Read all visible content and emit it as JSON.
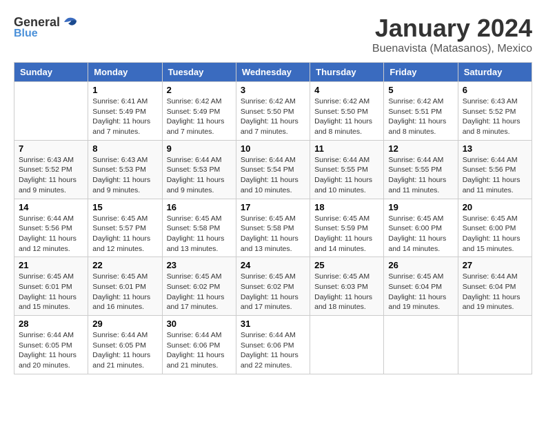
{
  "header": {
    "logo_general": "General",
    "logo_blue": "Blue",
    "month_title": "January 2024",
    "location": "Buenavista (Matasanos), Mexico"
  },
  "weekdays": [
    "Sunday",
    "Monday",
    "Tuesday",
    "Wednesday",
    "Thursday",
    "Friday",
    "Saturday"
  ],
  "weeks": [
    [
      {
        "day": "",
        "sunrise": "",
        "sunset": "",
        "daylight": ""
      },
      {
        "day": "1",
        "sunrise": "Sunrise: 6:41 AM",
        "sunset": "Sunset: 5:49 PM",
        "daylight": "Daylight: 11 hours and 7 minutes."
      },
      {
        "day": "2",
        "sunrise": "Sunrise: 6:42 AM",
        "sunset": "Sunset: 5:49 PM",
        "daylight": "Daylight: 11 hours and 7 minutes."
      },
      {
        "day": "3",
        "sunrise": "Sunrise: 6:42 AM",
        "sunset": "Sunset: 5:50 PM",
        "daylight": "Daylight: 11 hours and 7 minutes."
      },
      {
        "day": "4",
        "sunrise": "Sunrise: 6:42 AM",
        "sunset": "Sunset: 5:50 PM",
        "daylight": "Daylight: 11 hours and 8 minutes."
      },
      {
        "day": "5",
        "sunrise": "Sunrise: 6:42 AM",
        "sunset": "Sunset: 5:51 PM",
        "daylight": "Daylight: 11 hours and 8 minutes."
      },
      {
        "day": "6",
        "sunrise": "Sunrise: 6:43 AM",
        "sunset": "Sunset: 5:52 PM",
        "daylight": "Daylight: 11 hours and 8 minutes."
      }
    ],
    [
      {
        "day": "7",
        "sunrise": "Sunrise: 6:43 AM",
        "sunset": "Sunset: 5:52 PM",
        "daylight": "Daylight: 11 hours and 9 minutes."
      },
      {
        "day": "8",
        "sunrise": "Sunrise: 6:43 AM",
        "sunset": "Sunset: 5:53 PM",
        "daylight": "Daylight: 11 hours and 9 minutes."
      },
      {
        "day": "9",
        "sunrise": "Sunrise: 6:44 AM",
        "sunset": "Sunset: 5:53 PM",
        "daylight": "Daylight: 11 hours and 9 minutes."
      },
      {
        "day": "10",
        "sunrise": "Sunrise: 6:44 AM",
        "sunset": "Sunset: 5:54 PM",
        "daylight": "Daylight: 11 hours and 10 minutes."
      },
      {
        "day": "11",
        "sunrise": "Sunrise: 6:44 AM",
        "sunset": "Sunset: 5:55 PM",
        "daylight": "Daylight: 11 hours and 10 minutes."
      },
      {
        "day": "12",
        "sunrise": "Sunrise: 6:44 AM",
        "sunset": "Sunset: 5:55 PM",
        "daylight": "Daylight: 11 hours and 11 minutes."
      },
      {
        "day": "13",
        "sunrise": "Sunrise: 6:44 AM",
        "sunset": "Sunset: 5:56 PM",
        "daylight": "Daylight: 11 hours and 11 minutes."
      }
    ],
    [
      {
        "day": "14",
        "sunrise": "Sunrise: 6:44 AM",
        "sunset": "Sunset: 5:56 PM",
        "daylight": "Daylight: 11 hours and 12 minutes."
      },
      {
        "day": "15",
        "sunrise": "Sunrise: 6:45 AM",
        "sunset": "Sunset: 5:57 PM",
        "daylight": "Daylight: 11 hours and 12 minutes."
      },
      {
        "day": "16",
        "sunrise": "Sunrise: 6:45 AM",
        "sunset": "Sunset: 5:58 PM",
        "daylight": "Daylight: 11 hours and 13 minutes."
      },
      {
        "day": "17",
        "sunrise": "Sunrise: 6:45 AM",
        "sunset": "Sunset: 5:58 PM",
        "daylight": "Daylight: 11 hours and 13 minutes."
      },
      {
        "day": "18",
        "sunrise": "Sunrise: 6:45 AM",
        "sunset": "Sunset: 5:59 PM",
        "daylight": "Daylight: 11 hours and 14 minutes."
      },
      {
        "day": "19",
        "sunrise": "Sunrise: 6:45 AM",
        "sunset": "Sunset: 6:00 PM",
        "daylight": "Daylight: 11 hours and 14 minutes."
      },
      {
        "day": "20",
        "sunrise": "Sunrise: 6:45 AM",
        "sunset": "Sunset: 6:00 PM",
        "daylight": "Daylight: 11 hours and 15 minutes."
      }
    ],
    [
      {
        "day": "21",
        "sunrise": "Sunrise: 6:45 AM",
        "sunset": "Sunset: 6:01 PM",
        "daylight": "Daylight: 11 hours and 15 minutes."
      },
      {
        "day": "22",
        "sunrise": "Sunrise: 6:45 AM",
        "sunset": "Sunset: 6:01 PM",
        "daylight": "Daylight: 11 hours and 16 minutes."
      },
      {
        "day": "23",
        "sunrise": "Sunrise: 6:45 AM",
        "sunset": "Sunset: 6:02 PM",
        "daylight": "Daylight: 11 hours and 17 minutes."
      },
      {
        "day": "24",
        "sunrise": "Sunrise: 6:45 AM",
        "sunset": "Sunset: 6:02 PM",
        "daylight": "Daylight: 11 hours and 17 minutes."
      },
      {
        "day": "25",
        "sunrise": "Sunrise: 6:45 AM",
        "sunset": "Sunset: 6:03 PM",
        "daylight": "Daylight: 11 hours and 18 minutes."
      },
      {
        "day": "26",
        "sunrise": "Sunrise: 6:45 AM",
        "sunset": "Sunset: 6:04 PM",
        "daylight": "Daylight: 11 hours and 19 minutes."
      },
      {
        "day": "27",
        "sunrise": "Sunrise: 6:44 AM",
        "sunset": "Sunset: 6:04 PM",
        "daylight": "Daylight: 11 hours and 19 minutes."
      }
    ],
    [
      {
        "day": "28",
        "sunrise": "Sunrise: 6:44 AM",
        "sunset": "Sunset: 6:05 PM",
        "daylight": "Daylight: 11 hours and 20 minutes."
      },
      {
        "day": "29",
        "sunrise": "Sunrise: 6:44 AM",
        "sunset": "Sunset: 6:05 PM",
        "daylight": "Daylight: 11 hours and 21 minutes."
      },
      {
        "day": "30",
        "sunrise": "Sunrise: 6:44 AM",
        "sunset": "Sunset: 6:06 PM",
        "daylight": "Daylight: 11 hours and 21 minutes."
      },
      {
        "day": "31",
        "sunrise": "Sunrise: 6:44 AM",
        "sunset": "Sunset: 6:06 PM",
        "daylight": "Daylight: 11 hours and 22 minutes."
      },
      {
        "day": "",
        "sunrise": "",
        "sunset": "",
        "daylight": ""
      },
      {
        "day": "",
        "sunrise": "",
        "sunset": "",
        "daylight": ""
      },
      {
        "day": "",
        "sunrise": "",
        "sunset": "",
        "daylight": ""
      }
    ]
  ]
}
